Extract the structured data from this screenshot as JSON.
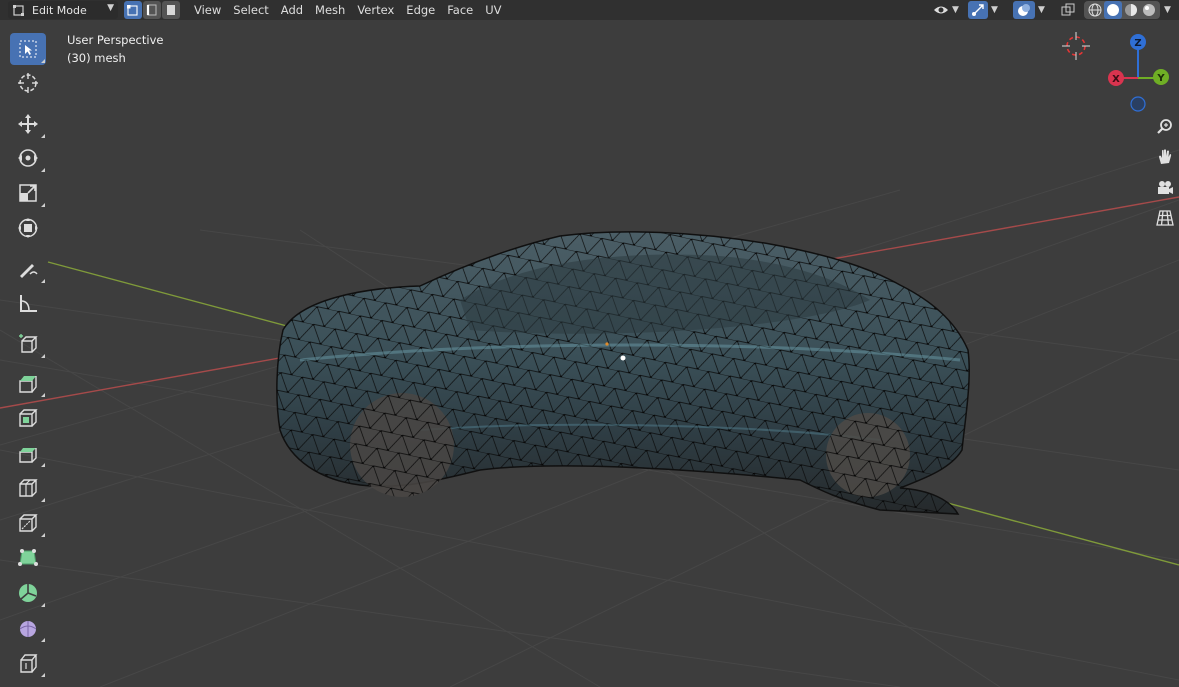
{
  "header": {
    "mode_label": "Edit Mode",
    "mode_icon": "edit-mode-icon",
    "select_modes": [
      "vertex-select-icon",
      "edge-select-icon",
      "face-select-icon"
    ],
    "active_select_mode": "vertex",
    "menu": [
      "View",
      "Select",
      "Add",
      "Mesh",
      "Vertex",
      "Edge",
      "Face",
      "UV"
    ],
    "right_icons": [
      "visibility-icon",
      "gizmo-icon",
      "overlay-icon",
      "xray-icon",
      "wireframe-shading-icon",
      "solid-shading-icon",
      "material-shading-icon",
      "rendered-shading-icon"
    ],
    "active_shading": "solid"
  },
  "viewport": {
    "view_name": "User Perspective",
    "object_info": "(30) mesh",
    "background_color": "#3d3d3d",
    "x_axis_color": "#a54a4a",
    "y_axis_color": "#7f9a3a"
  },
  "toolbar": {
    "tools": [
      "select-box-icon",
      "cursor-icon",
      "move-icon",
      "rotate-icon",
      "scale-icon",
      "transform-icon",
      "annotate-icon",
      "measure-icon",
      "add-cube-icon",
      "extrude-region-icon",
      "inset-faces-icon",
      "bevel-icon",
      "loop-cut-icon",
      "knife-icon",
      "poly-build-icon",
      "spin-icon",
      "smooth-icon",
      "shrink-fatten-icon"
    ],
    "active_tool": "select-box-icon"
  },
  "gizmo": {
    "axes": [
      {
        "label": "Z",
        "color": "#2f6fd6"
      },
      {
        "label": "Y",
        "color": "#6fae25"
      },
      {
        "label": "X",
        "color": "#d9344f"
      }
    ]
  },
  "nav_buttons": [
    "zoom-icon",
    "pan-hand-icon",
    "camera-view-icon",
    "ortho-grid-icon"
  ]
}
